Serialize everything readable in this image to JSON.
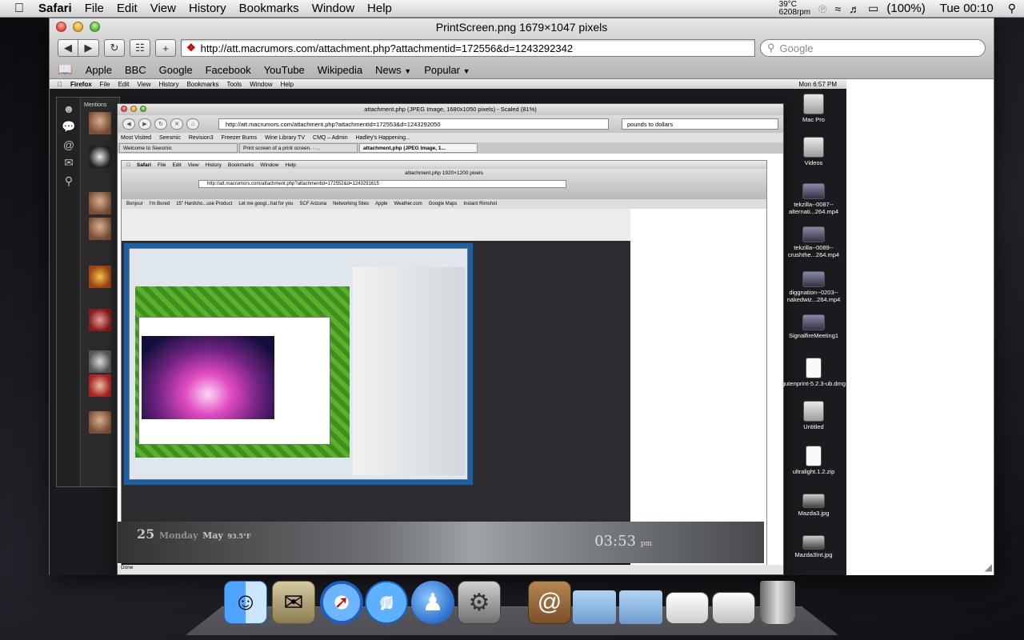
{
  "menubar": {
    "app": "Safari",
    "menus": [
      "File",
      "Edit",
      "View",
      "History",
      "Bookmarks",
      "Window",
      "Help"
    ],
    "temp": "39°C",
    "rpm": "6208rpm",
    "battery": "(100%)",
    "clock": "Tue 00:10"
  },
  "window": {
    "title": "PrintScreen.png 1679×1047 pixels",
    "url": "http://att.macrumors.com/attachment.php?attachmentid=172556&d=1243292342",
    "search_placeholder": "Google",
    "bookmarks": [
      "Apple",
      "BBC",
      "Google",
      "Facebook",
      "YouTube",
      "Wikipedia",
      "News",
      "Popular"
    ]
  },
  "inner": {
    "ff_menubar": [
      "Firefox",
      "File",
      "Edit",
      "View",
      "History",
      "Bookmarks",
      "Tools",
      "Window",
      "Help"
    ],
    "ff_clock": "Mon 6:57 PM",
    "seesmic_label": "Mentions",
    "ff_title": "attachment.php (JPEG Image, 1680x1050 pixels) - Scaled (81%)",
    "ff_url": "http://att.macrumors.com/attachment.php?attachmentid=172553&d=1243292050",
    "ff_search": "pounds to dollars",
    "ff_bookmarks": [
      "Most Visited",
      "Seesmic",
      "Revision3",
      "Freezer Burns",
      "Wine Library TV",
      "CMQ – Admin",
      "Hadley's Happening..."
    ],
    "ff_tabs": [
      "Welcome to Seesmic",
      "Print screen of a print screen. - ...",
      "attachment.php (JPEG Image, 1..."
    ],
    "ff_status": "Done",
    "nest_title": "attachment.php 1920×1200 pixels",
    "nest_url": "http://att.macrumors.com/attachment.php?attachmentid=172552&d=1243291615",
    "nest_menubar": [
      "Safari",
      "File",
      "Edit",
      "View",
      "History",
      "Bookmarks",
      "Window",
      "Help"
    ],
    "nest_bookmarks": [
      "Bonjour",
      "I'm Bored",
      "15\" Hardsho...use Product",
      "Let me googl...hat for you",
      "SCF Arizona",
      "Networking Sites",
      "Apple",
      "Weather.com",
      "Google Maps",
      "Instant Rimshot"
    ],
    "wallpaper_date": "Monday",
    "wallpaper_day": "25",
    "wallpaper_month": "May",
    "wallpaper_temp": "93.5°F",
    "wallpaper_time": "03:53",
    "wallpaper_ampm": "pm"
  },
  "desktop_icons": [
    {
      "label": "Mac Pro",
      "kind": "drive"
    },
    {
      "label": "Videos",
      "kind": "drive"
    },
    {
      "label": "tekzilla--0087--alternati...264.mp4",
      "kind": "pic"
    },
    {
      "label": "tekzilla--0089--crushthe...264.mp4",
      "kind": "pic"
    },
    {
      "label": "diggnation--0203--nakedwiz...264.mp4",
      "kind": "pic"
    },
    {
      "label": "SignalfireMeeting1",
      "kind": "pic"
    },
    {
      "label": "gutenprint-5.2.3-ub.dmg",
      "kind": "doc"
    },
    {
      "label": "Untitled",
      "kind": "drive"
    },
    {
      "label": "ultralight.1.2.zip",
      "kind": "doc"
    },
    {
      "label": "Mazda3.jpg",
      "kind": "car"
    },
    {
      "label": "Mazda3Int.jpg",
      "kind": "car"
    }
  ],
  "dock": [
    "Finder",
    "Mail",
    "Safari",
    "iTunes",
    "iChat",
    "System Preferences",
    "Address Book",
    "Applications",
    "Documents",
    "Screenshots",
    "Downloads",
    "Trash"
  ]
}
